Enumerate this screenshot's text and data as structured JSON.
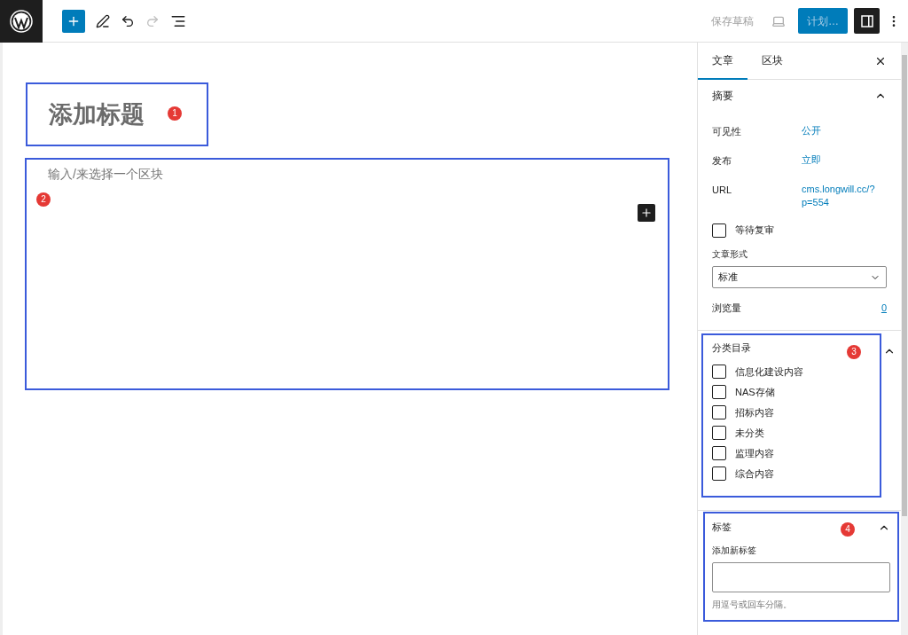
{
  "toolbar": {
    "save_draft": "保存草稿",
    "schedule": "计划…",
    "redo_disabled": true
  },
  "editor": {
    "title_placeholder": "添加标题",
    "title_marker": "1",
    "body_placeholder": "输入/来选择一个区块",
    "body_marker": "2"
  },
  "sidebar": {
    "tabs": [
      {
        "label": "文章",
        "selected": true
      },
      {
        "label": "区块",
        "selected": false
      }
    ],
    "summary": {
      "heading": "摘要",
      "expanded": true,
      "rows": [
        {
          "label": "可见性",
          "value": "公开"
        },
        {
          "label": "发布",
          "value": "立即"
        },
        {
          "label": "URL",
          "value": "cms.longwill.cc/?p=554"
        }
      ],
      "pending_review": {
        "label": "等待复审",
        "checked": false
      },
      "format": {
        "label": "文章形式",
        "value": "标准"
      },
      "views": {
        "label": "浏览量",
        "value": "0"
      }
    },
    "categories": {
      "heading": "分类目录",
      "marker": "3",
      "expanded": true,
      "items": [
        {
          "label": "信息化建设内容",
          "checked": false
        },
        {
          "label": "NAS存储",
          "checked": false
        },
        {
          "label": "招标内容",
          "checked": false
        },
        {
          "label": "未分类",
          "checked": false
        },
        {
          "label": "监理内容",
          "checked": false
        },
        {
          "label": "综合内容",
          "checked": false
        }
      ]
    },
    "tags": {
      "heading": "标签",
      "marker": "4",
      "expanded": true,
      "field_label": "添加新标签",
      "help": "用逗号或回车分隔。"
    }
  }
}
